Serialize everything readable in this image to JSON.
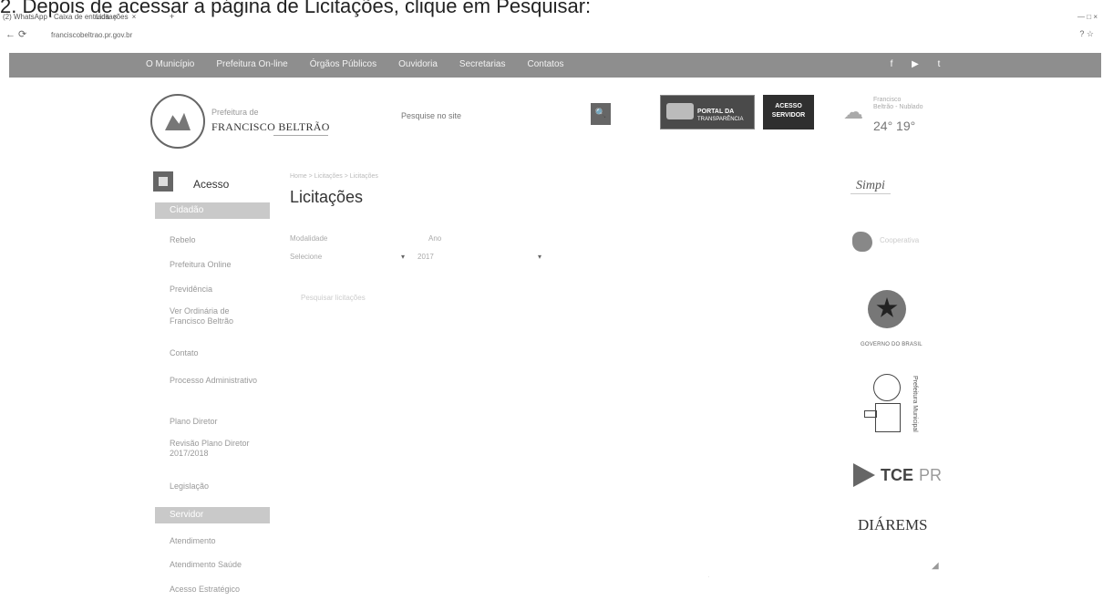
{
  "caption": "2. Depois de acessar a página de Licitações, clique em Pesquisar:",
  "browser": {
    "tabs": [
      {
        "label": "(2) WhatsApp - Caixa de entrada"
      },
      {
        "label": "Licitações"
      }
    ],
    "window_controls": "— □ ×",
    "url": "franciscobeltrao.pr.gov.br",
    "nav_icons": "← ⟳",
    "right_icons": "? ☆"
  },
  "top_nav": {
    "items": [
      "O Município",
      "Prefeitura On-line",
      "Órgãos Públicos",
      "Ouvidoria",
      "Secretarias",
      "Contatos"
    ],
    "social_icons": [
      "facebook-icon",
      "youtube-icon",
      "twitter-icon"
    ]
  },
  "header": {
    "brand_small": "Prefeitura de",
    "brand_name": "FRANCISCO BELTRÃO",
    "search_placeholder": "Pesquise no site",
    "search_glyph": "🔍",
    "portal_label": "PORTAL DA",
    "portal_label2": "TRANSPARÊNCIA",
    "servidor_label_1": "ACESSO",
    "servidor_label_2": "SERVIDOR",
    "weather_text_1": "Francisco",
    "weather_text_2": "Beltrão - Nublado",
    "weather_temp": "24°  19°"
  },
  "sidebar": {
    "acesso_label": "Acesso",
    "sections": [
      {
        "title": "Cidadão",
        "items": [
          "Rebelo",
          "Prefeitura Online",
          "Previdência",
          "Ver Ordinária de Francisco Beltrão",
          "Contato",
          "Processo Administrativo",
          "Plano Diretor",
          "Revisão Plano Diretor 2017/2018",
          "Legislação"
        ]
      },
      {
        "title": "Servidor",
        "items": [
          "Atendimento",
          "Atendimento Saúde",
          "Acesso Estratégico"
        ]
      }
    ]
  },
  "main": {
    "breadcrumb": "Home > Licitações > Licitações",
    "title": "Licitações",
    "modalidade_label": "Modalidade",
    "modalidade_value": "Selecione",
    "ano_label": "Ano",
    "ano_value": "2017",
    "search_link": "Pesquisar licitações"
  },
  "right_logos": {
    "logo1": "Simpi",
    "logo2": "Cooperativa",
    "logo3_text": "GOVERNO DO BRASIL",
    "logo4_vertical": "Prefeitura Municipal",
    "logo5_a": "TCE",
    "logo5_b": "PR",
    "logo6": "DIÁREMS"
  }
}
